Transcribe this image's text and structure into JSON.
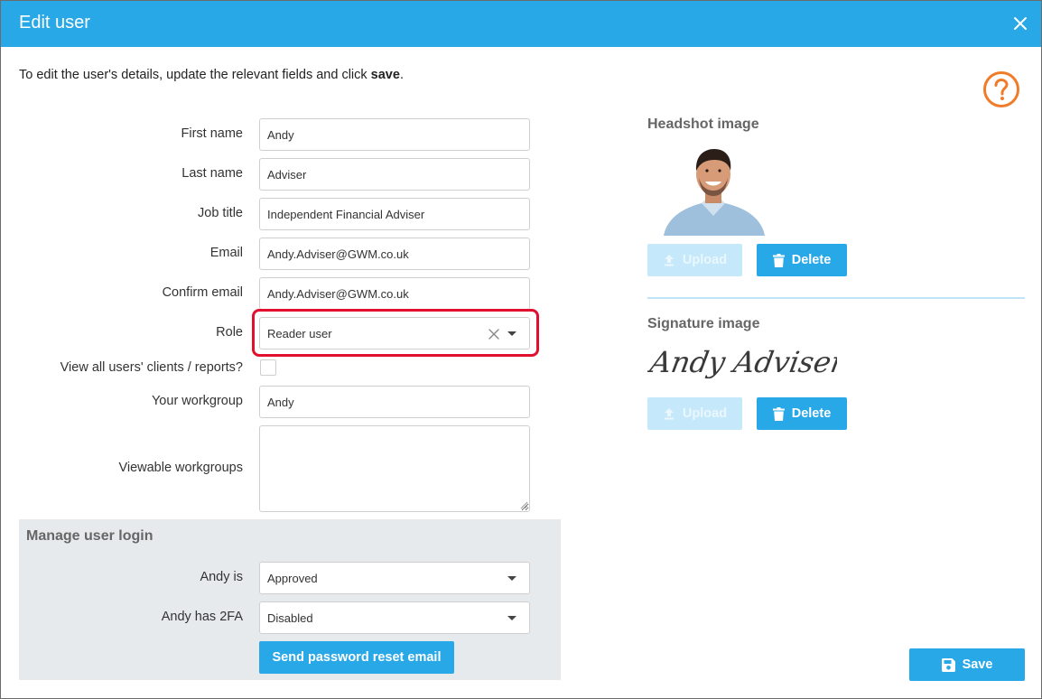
{
  "dialog": {
    "title": "Edit user",
    "intro_text": "To edit the user's details, update the relevant fields and click ",
    "intro_bold": "save",
    "intro_end": "."
  },
  "form": {
    "first_name": {
      "label": "First name",
      "value": "Andy"
    },
    "last_name": {
      "label": "Last name",
      "value": "Adviser"
    },
    "job_title": {
      "label": "Job title",
      "value": "Independent Financial Adviser"
    },
    "email": {
      "label": "Email",
      "value": "Andy.Adviser@GWM.co.uk"
    },
    "confirm_email": {
      "label": "Confirm email",
      "value": "Andy.Adviser@GWM.co.uk"
    },
    "role": {
      "label": "Role",
      "value": "Reader user"
    },
    "view_all": {
      "label": "View all users' clients / reports?",
      "checked": false
    },
    "your_workgroup": {
      "label": "Your workgroup",
      "value": "Andy"
    },
    "viewable_workgroups": {
      "label": "Viewable workgroups",
      "value": ""
    }
  },
  "manage_login": {
    "title": "Manage user login",
    "status": {
      "label": "Andy is",
      "value": "Approved"
    },
    "twofa": {
      "label": "Andy has 2FA",
      "value": "Disabled"
    },
    "reset_button": "Send password reset email"
  },
  "headshot": {
    "title": "Headshot image",
    "upload_label": "Upload",
    "delete_label": "Delete"
  },
  "signature": {
    "title": "Signature image",
    "signature_text": "Andy Adviser",
    "upload_label": "Upload",
    "delete_label": "Delete"
  },
  "save_label": "Save",
  "colors": {
    "primary": "#29a8e8",
    "primary_disabled": "#c5e8fa",
    "highlight": "#e0102e",
    "help": "#f07c2a",
    "panel": "#e6eaec"
  }
}
